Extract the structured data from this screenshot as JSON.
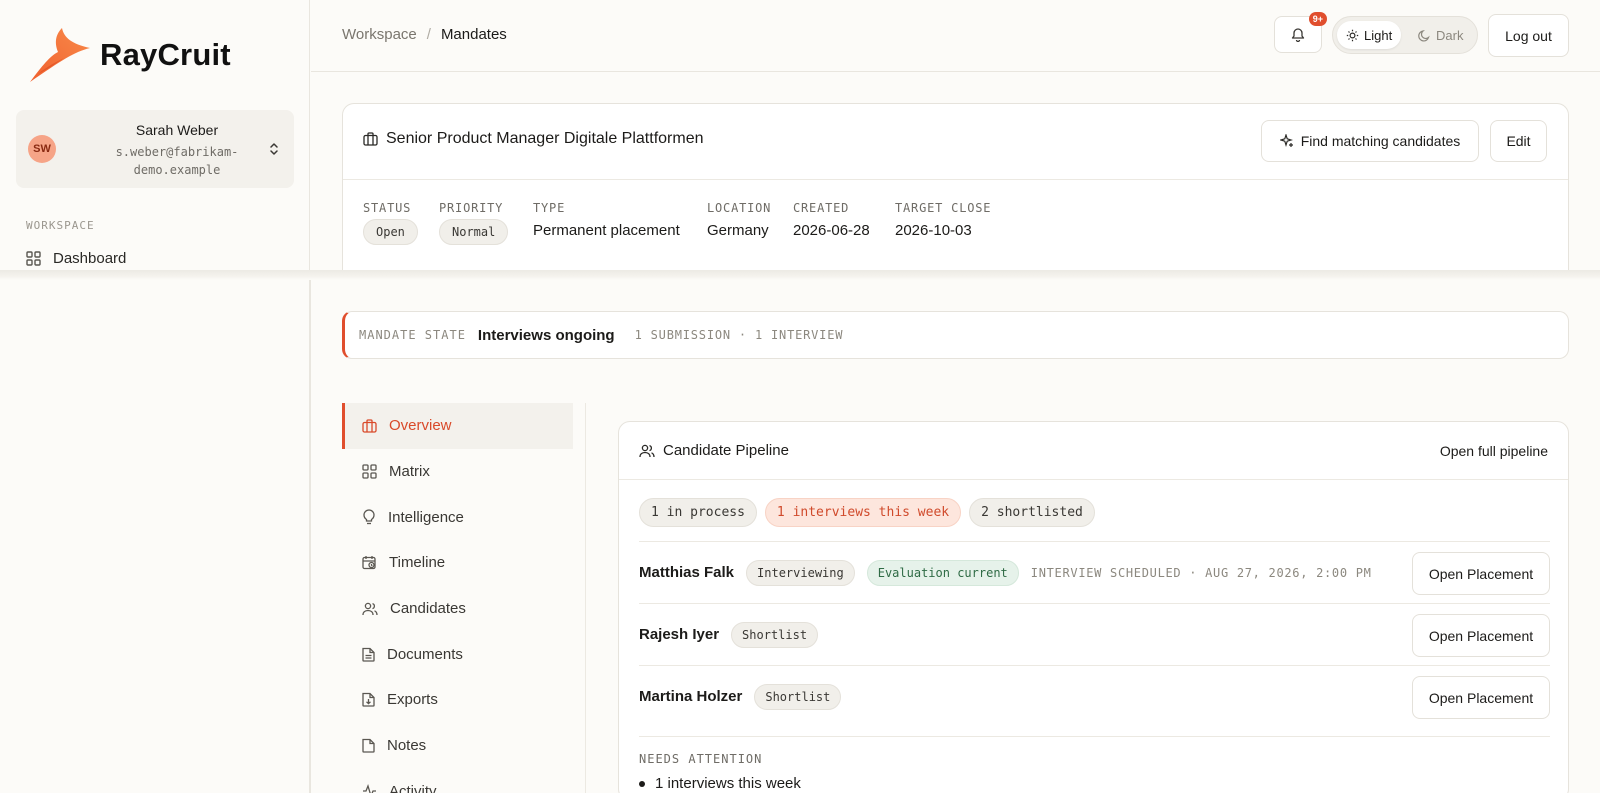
{
  "brand": {
    "name": "RayCruit",
    "accent": "#e04e2d"
  },
  "user": {
    "initials": "SW",
    "name": "Sarah Weber",
    "email": "s.weber@fabrikam-demo.example"
  },
  "sidebar": {
    "section_label": "WORKSPACE",
    "items": [
      {
        "label": "Dashboard",
        "icon": "grid-icon"
      }
    ]
  },
  "header": {
    "breadcrumb": {
      "parent": "Workspace",
      "separator": "/",
      "current": "Mandates"
    },
    "notifications_badge": "9+",
    "theme": {
      "light_label": "Light",
      "dark_label": "Dark",
      "selected": "Light"
    },
    "logout_label": "Log out"
  },
  "mandate": {
    "title": "Senior Product Manager Digitale Plattformen",
    "find_label": "Find matching candidates",
    "edit_label": "Edit",
    "meta": {
      "status": {
        "label": "STATUS",
        "value": "Open"
      },
      "priority": {
        "label": "PRIORITY",
        "value": "Normal"
      },
      "type": {
        "label": "TYPE",
        "value": "Permanent placement"
      },
      "location": {
        "label": "LOCATION",
        "value": "Germany"
      },
      "created": {
        "label": "CREATED",
        "value": "2026-06-28"
      },
      "target_close": {
        "label": "TARGET CLOSE",
        "value": "2026-10-03"
      }
    }
  },
  "state": {
    "label": "MANDATE STATE",
    "value": "Interviews ongoing",
    "summary": "1 SUBMISSION · 1 INTERVIEW"
  },
  "subnav": [
    {
      "label": "Overview",
      "icon": "briefcase-icon",
      "active": true
    },
    {
      "label": "Matrix",
      "icon": "grid-icon"
    },
    {
      "label": "Intelligence",
      "icon": "lightbulb-icon"
    },
    {
      "label": "Timeline",
      "icon": "calendar-clock-icon"
    },
    {
      "label": "Candidates",
      "icon": "users-icon"
    },
    {
      "label": "Documents",
      "icon": "document-icon"
    },
    {
      "label": "Exports",
      "icon": "file-download-icon"
    },
    {
      "label": "Notes",
      "icon": "file-icon"
    },
    {
      "label": "Activity",
      "icon": "activity-icon"
    }
  ],
  "pipeline": {
    "title": "Candidate Pipeline",
    "open_full_label": "Open full pipeline",
    "chips": [
      "1 in process",
      "1 interviews this week",
      "2 shortlisted"
    ],
    "open_placement_label": "Open Placement",
    "candidates": [
      {
        "name": "Matthias Falk",
        "stage": "Interviewing",
        "evaluation": "Evaluation current",
        "note": "INTERVIEW SCHEDULED · AUG 27, 2026, 2:00 PM"
      },
      {
        "name": "Rajesh Iyer",
        "stage": "Shortlist"
      },
      {
        "name": "Martina Holzer",
        "stage": "Shortlist"
      }
    ],
    "needs_attention": {
      "label": "NEEDS ATTENTION",
      "items": [
        "1 interviews this week"
      ]
    }
  }
}
